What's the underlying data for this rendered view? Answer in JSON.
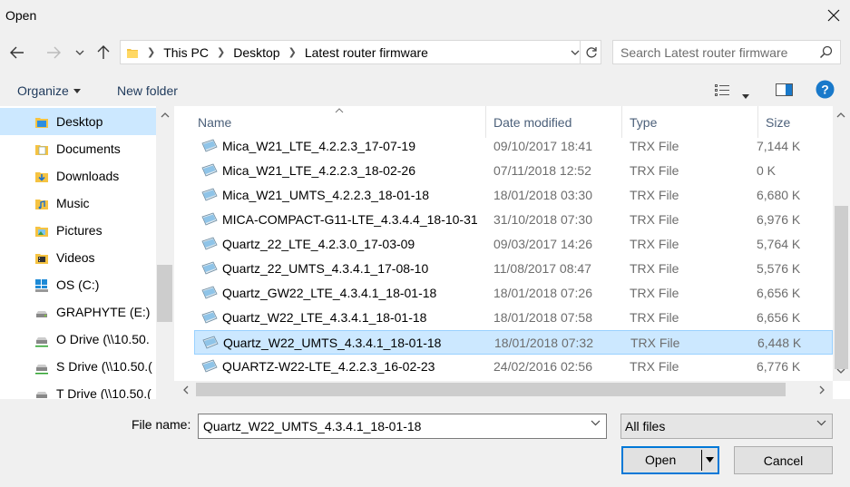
{
  "window": {
    "title": "Open"
  },
  "address": {
    "crumbs": [
      "This PC",
      "Desktop",
      "Latest router firmware"
    ]
  },
  "search": {
    "placeholder": "Search Latest router firmware"
  },
  "toolbar": {
    "organize_label": "Organize",
    "new_folder_label": "New folder"
  },
  "nav": {
    "items": [
      {
        "label": "Desktop",
        "icon": "desktop-folder-icon",
        "selected": true
      },
      {
        "label": "Documents",
        "icon": "documents-folder-icon"
      },
      {
        "label": "Downloads",
        "icon": "downloads-folder-icon"
      },
      {
        "label": "Music",
        "icon": "music-folder-icon"
      },
      {
        "label": "Pictures",
        "icon": "pictures-folder-icon"
      },
      {
        "label": "Videos",
        "icon": "videos-folder-icon"
      },
      {
        "label": "OS (C:)",
        "icon": "windows-drive-icon"
      },
      {
        "label": "GRAPHYTE (E:)",
        "icon": "drive-icon"
      },
      {
        "label": "O Drive (\\\\10.50.",
        "icon": "network-drive-icon"
      },
      {
        "label": "S Drive (\\\\10.50.(",
        "icon": "network-drive-icon"
      },
      {
        "label": "T Drive (\\\\10.50.(",
        "icon": "network-drive-icon"
      }
    ]
  },
  "columns": {
    "name": "Name",
    "date": "Date modified",
    "type": "Type",
    "size": "Size"
  },
  "files": [
    {
      "name": "Mica_W21_LTE_4.2.2.3_17-07-19",
      "date": "09/10/2017 18:41",
      "type": "TRX File",
      "size": "7,144 K"
    },
    {
      "name": "Mica_W21_LTE_4.2.2.3_18-02-26",
      "date": "07/11/2018 12:52",
      "type": "TRX File",
      "size": "0 K"
    },
    {
      "name": "Mica_W21_UMTS_4.2.2.3_18-01-18",
      "date": "18/01/2018 03:30",
      "type": "TRX File",
      "size": "6,680 K"
    },
    {
      "name": "MICA-COMPACT-G11-LTE_4.3.4.4_18-10-31",
      "date": "31/10/2018 07:30",
      "type": "TRX File",
      "size": "6,976 K"
    },
    {
      "name": "Quartz_22_LTE_4.2.3.0_17-03-09",
      "date": "09/03/2017 14:26",
      "type": "TRX File",
      "size": "5,764 K"
    },
    {
      "name": "Quartz_22_UMTS_4.3.4.1_17-08-10",
      "date": "11/08/2017 08:47",
      "type": "TRX File",
      "size": "5,576 K"
    },
    {
      "name": "Quartz_GW22_LTE_4.3.4.1_18-01-18",
      "date": "18/01/2018 07:26",
      "type": "TRX File",
      "size": "6,656 K"
    },
    {
      "name": "Quartz_W22_LTE_4.3.4.1_18-01-18",
      "date": "18/01/2018 07:58",
      "type": "TRX File",
      "size": "6,656 K"
    },
    {
      "name": "Quartz_W22_UMTS_4.3.4.1_18-01-18",
      "date": "18/01/2018 07:32",
      "type": "TRX File",
      "size": "6,448 K",
      "selected": true
    },
    {
      "name": "QUARTZ-W22-LTE_4.2.2.3_16-02-23",
      "date": "24/02/2016 02:56",
      "type": "TRX File",
      "size": "6,776 K"
    }
  ],
  "footer": {
    "file_name_label": "File name:",
    "file_name_value": "Quartz_W22_UMTS_4.3.4.1_18-01-18",
    "filter_value": "All files",
    "open_label": "Open",
    "cancel_label": "Cancel"
  },
  "colors": {
    "accent": "#0078d7",
    "selection": "#cce8ff",
    "help": "#1979ca"
  }
}
